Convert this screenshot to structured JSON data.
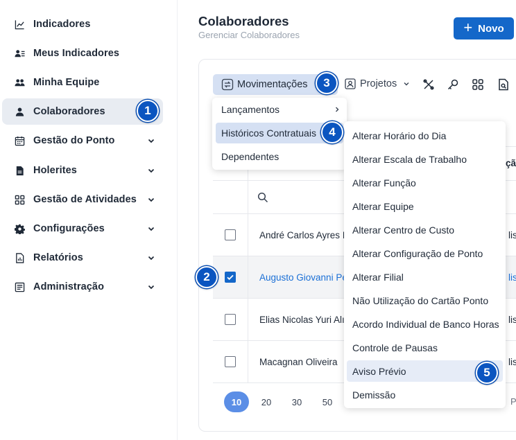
{
  "sidebar": {
    "items": [
      {
        "label": "Indicadores",
        "icon": "chart-line-icon",
        "chevron": false,
        "active": false
      },
      {
        "label": "Meus Indicadores",
        "icon": "user-list-icon",
        "chevron": false,
        "active": false
      },
      {
        "label": "Minha Equipe",
        "icon": "users-icon",
        "chevron": false,
        "active": false
      },
      {
        "label": "Colaboradores",
        "icon": "user-icon",
        "chevron": false,
        "active": true
      },
      {
        "label": "Gestão do Ponto",
        "icon": "calendar-icon",
        "chevron": true,
        "active": false
      },
      {
        "label": "Holerites",
        "icon": "document-icon",
        "chevron": true,
        "active": false
      },
      {
        "label": "Gestão de Atividades",
        "icon": "grid-icon",
        "chevron": true,
        "active": false
      },
      {
        "label": "Configurações",
        "icon": "gear-icon",
        "chevron": true,
        "active": false
      },
      {
        "label": "Relatórios",
        "icon": "report-icon",
        "chevron": true,
        "active": false
      },
      {
        "label": "Administração",
        "icon": "admin-list-icon",
        "chevron": true,
        "active": false
      }
    ]
  },
  "header": {
    "title": "Colaboradores",
    "subtitle": "Gerenciar Colaboradores",
    "new_button": "Novo"
  },
  "toolbar": {
    "movimentacoes": "Movimentações",
    "projetos": "Projetos"
  },
  "menu_movimentacoes": {
    "items": [
      "Lançamentos",
      "Históricos Contratuais",
      "Dependentes"
    ]
  },
  "menu_historicos": {
    "items": [
      "Alterar Horário do Dia",
      "Alterar Escala de Trabalho",
      "Alterar Função",
      "Alterar Equipe",
      "Alterar Centro de Custo",
      "Alterar Configuração de Ponto",
      "Alterar Filial",
      "Não Utilização do Cartão Ponto",
      "Acordo Individual de Banco Horas",
      "Controle de Pausas",
      "Aviso Prévio",
      "Demissão"
    ]
  },
  "table": {
    "header_tail": "çã",
    "rows": [
      {
        "name": "André Carlos Ayres I",
        "tail": "list",
        "checked": false
      },
      {
        "name": "Augusto Giovanni Pe",
        "tail": "list",
        "checked": true
      },
      {
        "name": "Elias Nicolas Yuri Alı",
        "tail": "list",
        "checked": false
      },
      {
        "name": "Macagnan Oliveira",
        "tail": "list",
        "checked": false
      }
    ]
  },
  "pagination": {
    "sizes": [
      "10",
      "20",
      "30",
      "50"
    ],
    "current": "10",
    "tail": "P"
  },
  "badges": [
    "1",
    "2",
    "3",
    "4",
    "5"
  ],
  "colors": {
    "primary": "#1467c9",
    "badge": "#0b55c0",
    "highlight": "#d5e0f3",
    "link": "#1a6fd6"
  }
}
